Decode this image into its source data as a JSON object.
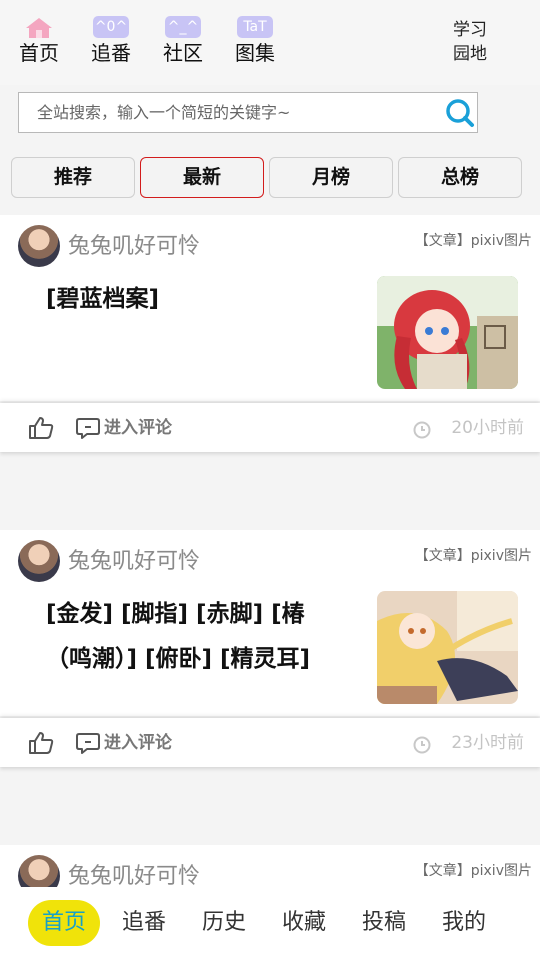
{
  "topnav": {
    "items": [
      {
        "label": "首页",
        "badge": "",
        "icon": "house-icon"
      },
      {
        "label": "追番",
        "badge": "^0^",
        "icon": "emoticon-badge"
      },
      {
        "label": "社区",
        "badge": "^_^",
        "icon": "emoticon-badge"
      },
      {
        "label": "图集",
        "badge": "TaT",
        "icon": "emoticon-badge"
      }
    ],
    "study_label": "学习园地"
  },
  "search": {
    "placeholder": "全站搜索，输入一个简短的关键字~",
    "icon": "search-icon"
  },
  "tabs": [
    {
      "label": "推荐",
      "active": false
    },
    {
      "label": "最新",
      "active": true
    },
    {
      "label": "月榜",
      "active": false
    },
    {
      "label": "总榜",
      "active": false
    }
  ],
  "posts": [
    {
      "author": "兔兔叽好可怜",
      "category": "【文章】pixiv图片",
      "title": "[碧蓝档案]",
      "comment_label": "进入评论",
      "time": "20小时前"
    },
    {
      "author": "兔兔叽好可怜",
      "category": "【文章】pixiv图片",
      "title": "[金发] [脚指] [赤脚] [椿（鸣潮）] [俯卧] [精灵耳]",
      "comment_label": "进入评论",
      "time": "23小时前"
    },
    {
      "author": "兔兔叽好可怜",
      "category": "【文章】pixiv图片",
      "title": "",
      "comment_label": "",
      "time": ""
    }
  ],
  "bottombar": {
    "items": [
      {
        "label": "首页",
        "active": true
      },
      {
        "label": "追番",
        "active": false
      },
      {
        "label": "历史",
        "active": false
      },
      {
        "label": "收藏",
        "active": false
      },
      {
        "label": "投稿",
        "active": false
      },
      {
        "label": "我的",
        "active": false
      }
    ]
  },
  "colors": {
    "active_tab_border": "#d21c1c",
    "bottom_active_bg": "#f0e30a",
    "bottom_active_text": "#16a0c8",
    "search_icon": "#1aa0d8",
    "badge_bg": "#c8c4f5",
    "house_icon": "#f4a6c0"
  }
}
